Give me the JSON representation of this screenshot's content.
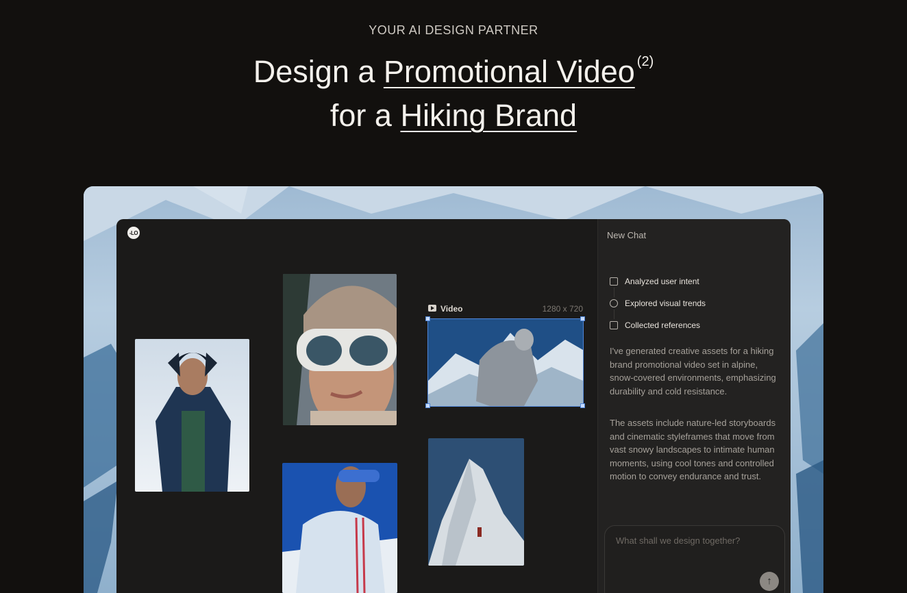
{
  "hero": {
    "eyebrow": "YOUR AI DESIGN PARTNER",
    "line1_prefix": "Design a ",
    "line1_link": "Promotional Video",
    "line1_sup": "(2)",
    "line2_prefix": "for a ",
    "line2_link": "Hiking Brand"
  },
  "canvas": {
    "video_label": "Video",
    "video_dims": "1280 x 720"
  },
  "chat": {
    "title": "New Chat",
    "steps": [
      {
        "label": "Analyzed user intent",
        "icon": "chat-icon"
      },
      {
        "label": "Explored visual trends",
        "icon": "globe-icon"
      },
      {
        "label": "Collected references",
        "icon": "grid-icon"
      }
    ],
    "paragraphs": [
      "I've generated creative assets for a hiking brand promotional video set in alpine, snow-covered environments, emphasizing durability and cold resistance.",
      "The assets include nature-led storyboards and cinematic styleframes that move from vast snowy landscapes to intimate human moments, using cool tones and controlled motion to convey endurance and trust."
    ],
    "input_placeholder": "What shall we design together?",
    "send_icon": "arrow-up-icon"
  },
  "colors": {
    "background": "#12100e",
    "panel": "#232221",
    "selection": "#4f85d8"
  }
}
